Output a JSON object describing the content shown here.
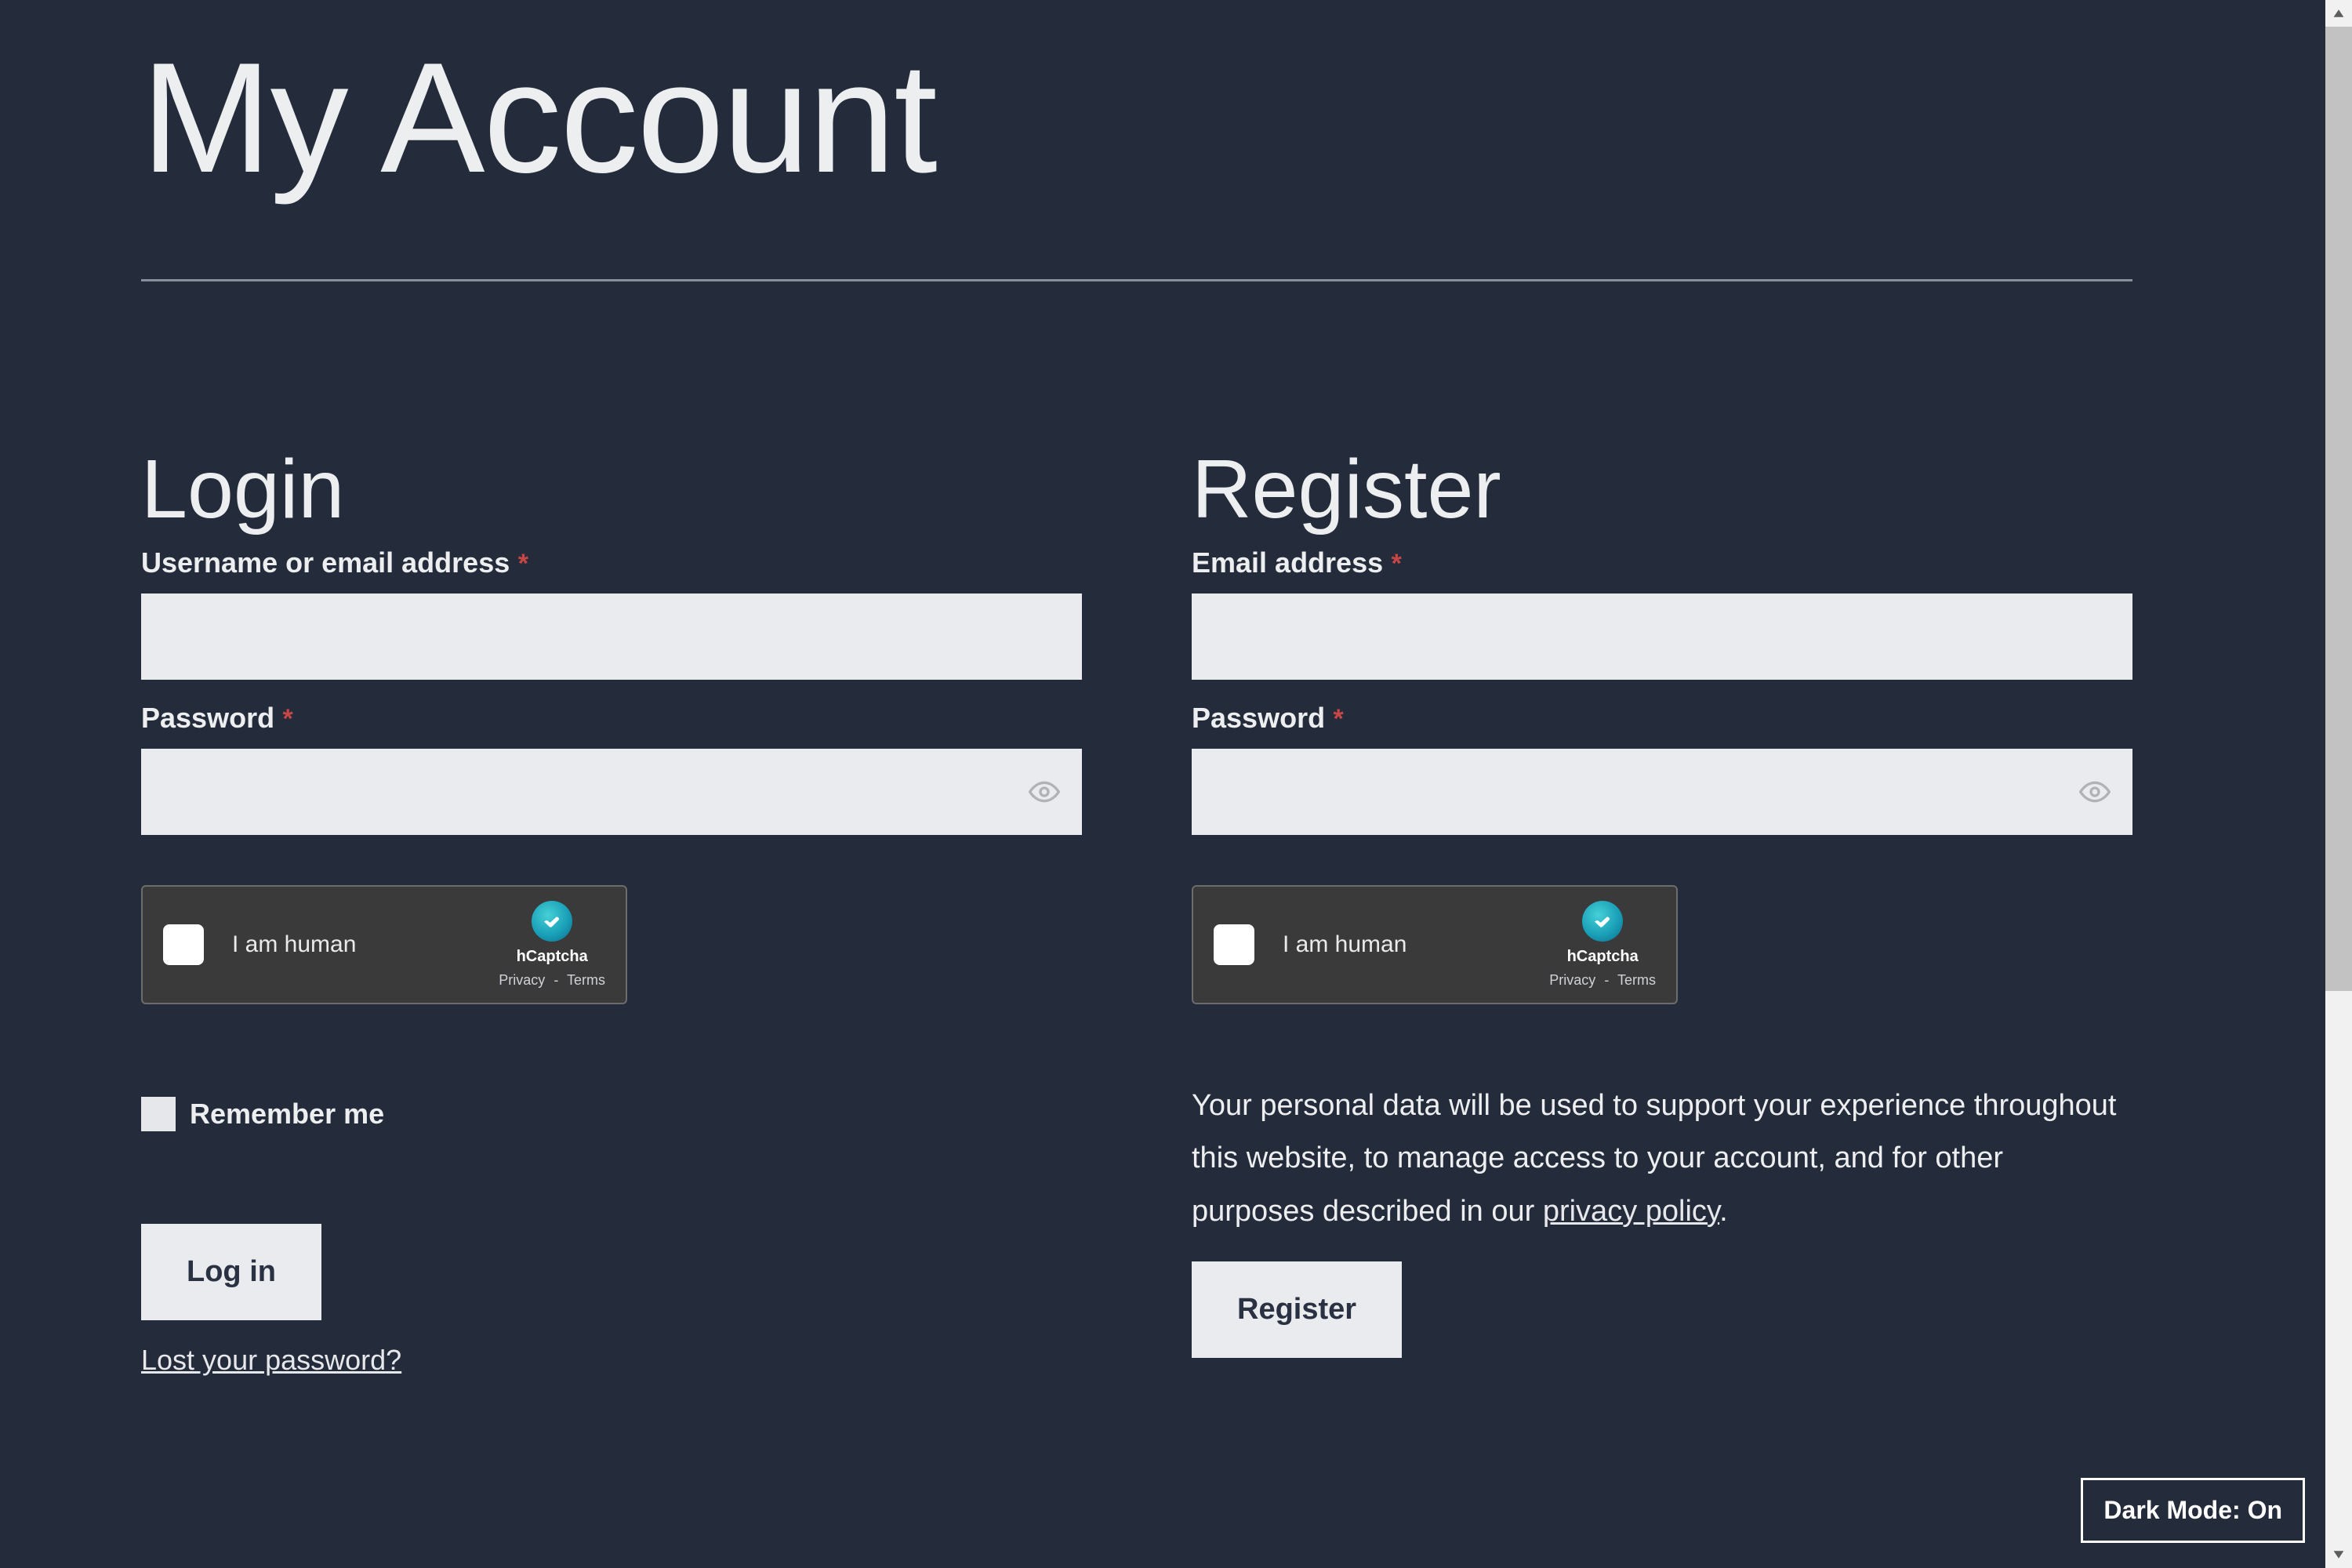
{
  "page": {
    "title": "My Account"
  },
  "login": {
    "heading": "Login",
    "username_label": "Username or email address",
    "username_value": "",
    "password_label": "Password",
    "password_value": "",
    "captcha": {
      "label": "I am human",
      "brand": "hCaptcha",
      "privacy": "Privacy",
      "terms": "Terms",
      "sep": "-"
    },
    "remember_label": "Remember me",
    "submit_label": "Log in",
    "lost_password": "Lost your password?"
  },
  "register": {
    "heading": "Register",
    "email_label": "Email address",
    "email_value": "",
    "password_label": "Password",
    "password_value": "",
    "captcha": {
      "label": "I am human",
      "brand": "hCaptcha",
      "privacy": "Privacy",
      "terms": "Terms",
      "sep": "-"
    },
    "privacy_text_pre": "Your personal data will be used to support your experience throughout this website, to manage access to your account, and for other purposes described in our ",
    "privacy_link": "privacy policy",
    "privacy_text_post": ".",
    "submit_label": "Register"
  },
  "required_marker": "*",
  "dark_mode_toggle": "Dark Mode: On"
}
